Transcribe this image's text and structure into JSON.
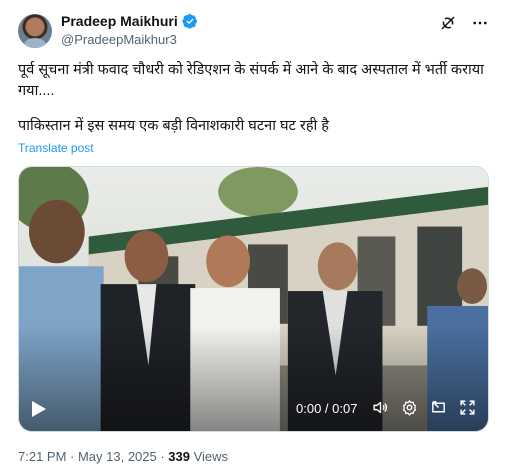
{
  "author": {
    "display_name": "Pradeep Maikhuri",
    "handle": "@PradeepMaikhur3"
  },
  "icons": {
    "verified": "verified-badge-icon",
    "grok": "grok-icon",
    "more": "more-options-icon",
    "play": "play-icon",
    "volume": "volume-icon",
    "settings": "settings-icon",
    "pip": "picture-in-picture-icon",
    "fullscreen": "fullscreen-icon"
  },
  "tweet": {
    "line1": "पूर्व सूचना मंत्री फवाद चौधरी को रेडिएशन के संपर्क में आने के बाद अस्पताल में भर्ती कराया गया....",
    "line2": "पाकिस्तान में इस समय एक बड़ी विनाशकारी घटना घट रही है",
    "translate_label": "Translate post"
  },
  "video": {
    "time": "0:00 / 0:07"
  },
  "meta": {
    "timestamp": "7:21 PM · May 13, 2025 · ",
    "views": "339",
    "views_label": " Views"
  },
  "colors": {
    "accent": "#1d9bf0",
    "text": "#0f1419",
    "secondary": "#536471"
  }
}
